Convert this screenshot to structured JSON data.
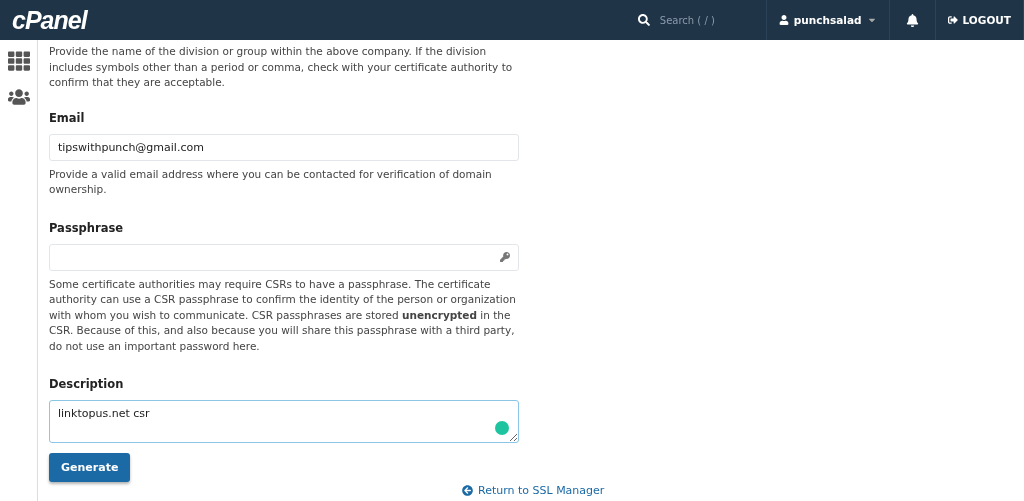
{
  "header": {
    "logo": "cPanel",
    "search": {
      "placeholder": "Search ( / )"
    },
    "user": "punchsalad",
    "logout": "LOGOUT"
  },
  "sidebar": {
    "items": [
      {
        "kind": "apps",
        "selected": false
      },
      {
        "kind": "users",
        "selected": false
      }
    ]
  },
  "intro_help": "Provide the name of the division or group within the above company. If the division includes symbols other than a period or comma, check with your certificate authority to confirm that they are acceptable.",
  "fields": [
    {
      "kind": "input",
      "label": "Email",
      "value": "tipswithpunch@gmail.com",
      "help": "Provide a valid email address where you can be contacted for verification of domain ownership."
    },
    {
      "kind": "password",
      "label": "Passphrase",
      "help": "Some certificate authorities may require CSRs to have a passphrase. The certificate authority can use a CSR passphrase to confirm the identity of the person or organization with whom you wish to communicate. CSR passphrases are stored **unencrypted** in the CSR. Because of this, and also because you will share this passphrase with a third party, do not use an important password here."
    },
    {
      "kind": "textarea",
      "label": "Description",
      "value": "linktopus.net csr"
    }
  ],
  "submit": "Generate",
  "return_link": "Return to SSL Manager"
}
